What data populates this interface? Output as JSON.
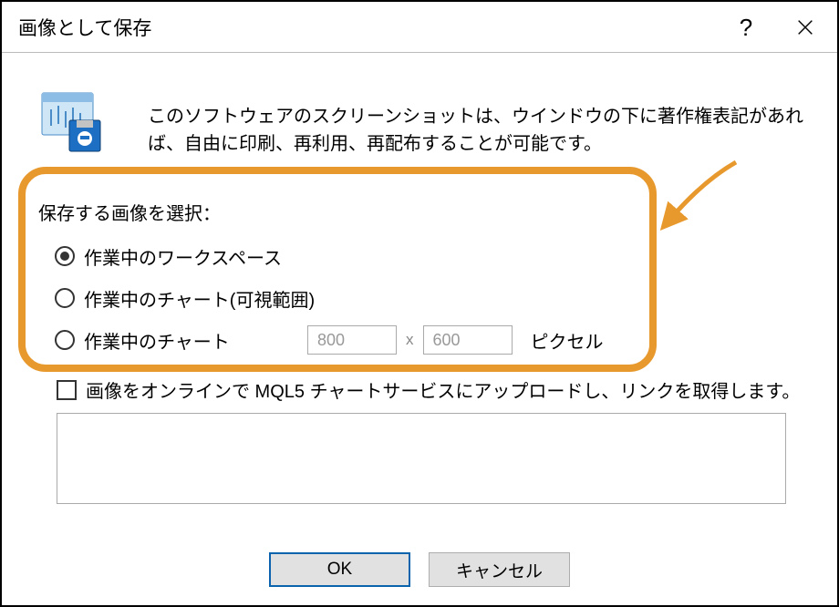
{
  "dialog": {
    "title": "画像として保存",
    "description": "このソフトウェアのスクリーンショットは、ウインドウの下に著作権表記があれば、自由に印刷、再利用、再配布することが可能です。",
    "group_label": "保存する画像を選択：",
    "options": {
      "workspace": "作業中のワークスペース",
      "chart_visible": "作業中のチャート(可視範囲)",
      "chart_custom": "作業中のチャート",
      "width_value": "800",
      "height_value": "600",
      "dim_separator": "x",
      "px_label": "ピクセル"
    },
    "upload_label": "画像をオンラインで MQL5 チャートサービスにアップロードし、リンクを取得します。",
    "ok_label": "OK",
    "cancel_label": "キャンセル"
  }
}
